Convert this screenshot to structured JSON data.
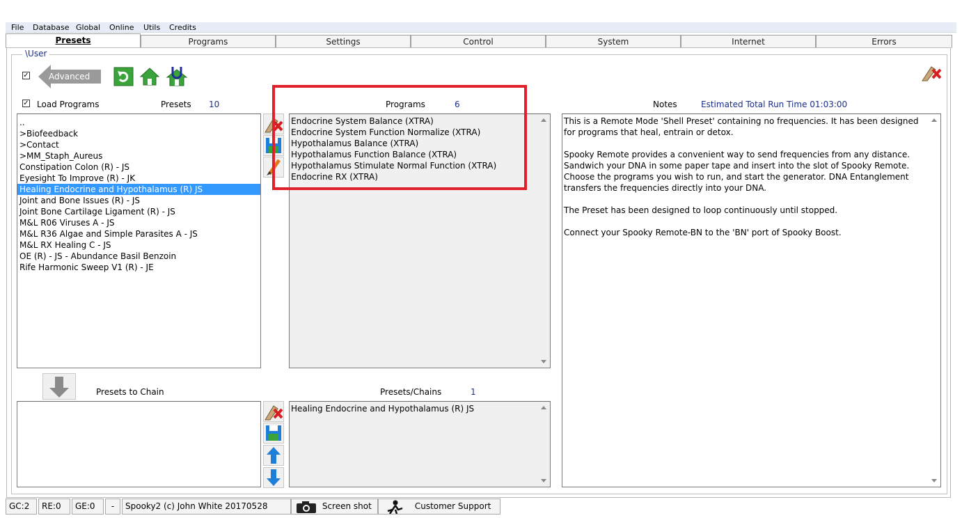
{
  "menu": [
    "File",
    "Database",
    "Global",
    "Online",
    "Utils",
    "Credits"
  ],
  "tabs": [
    "Presets",
    "Programs",
    "Settings",
    "Control",
    "System",
    "Internet",
    "Errors"
  ],
  "active_tab": "Presets",
  "path_label": "\\User",
  "advanced": {
    "label": "Advanced",
    "checked": "✓"
  },
  "load_programs": {
    "label": "Load Programs",
    "checked": "✓"
  },
  "presets_header": {
    "label": "Presets",
    "count": "10"
  },
  "presets_list": [
    "..",
    ">Biofeedback",
    ">Contact",
    ">MM_Staph_Aureus",
    "Constipation Colon (R) - JS",
    "Eyesight To Improve (R) - JK",
    "Healing Endocrine and Hypothalamus (R) JS",
    "Joint and Bone Issues (R) - JS",
    "Joint Bone Cartilage Ligament (R) - JS",
    "M&L R06 Viruses A - JS",
    "M&L R36 Algae and Simple Parasites A - JS",
    "M&L RX Healing C - JS",
    "OE (R) - JS - Abundance Basil Benzoin",
    "Rife Harmonic Sweep V1 (R) - JE"
  ],
  "selected_preset": "Healing Endocrine and Hypothalamus (R) JS",
  "programs_header": {
    "label": "Programs",
    "count": "6"
  },
  "programs_list": [
    "Endocrine System Balance (XTRA)",
    "Endocrine System Function Normalize (XTRA)",
    "Hypothalamus Balance (XTRA)",
    "Hypothalamus Function Balance (XTRA)",
    "Hypothalamus Stimulate Normal Function (XTRA)",
    "Endocrine RX (XTRA)"
  ],
  "notes_header": {
    "label": "Notes",
    "runtime": "Estimated Total Run Time 01:03:00"
  },
  "notes_paragraphs": [
    "This is a Remote Mode 'Shell Preset' containing no frequencies. It has been designed for programs that heal, entrain or detox.",
    "Spooky Remote provides a convenient way to send frequencies from any distance. Sandwich your DNA in some paper tape and insert into the slot of Spooky Remote. Choose the programs you wish to run, and start the generator. DNA Entanglement transfers the frequencies directly into your DNA.",
    "The Preset has been designed to loop continuously until stopped.",
    "Connect your Spooky Remote-BN to the 'BN' port of Spooky Boost."
  ],
  "chain_header": {
    "label": "Presets to Chain"
  },
  "chains_header": {
    "label": "Presets/Chains",
    "count": "1"
  },
  "chains_list": [
    "Healing Endocrine and Hypothalamus (R) JS"
  ],
  "status": {
    "gc": "GC:2",
    "re": "RE:0",
    "ge": "GE:0",
    "dash": "-",
    "copyright": "Spooky2 (c) John White 20170528",
    "screenshot": "Screen shot",
    "support": "Customer Support"
  },
  "colors": {
    "selection": "#3399ff",
    "highlight_box": "#e0202a",
    "label_blue": "#1a2e8a",
    "icon_green": "#3aa33a",
    "icon_blue": "#1e7fd8"
  }
}
